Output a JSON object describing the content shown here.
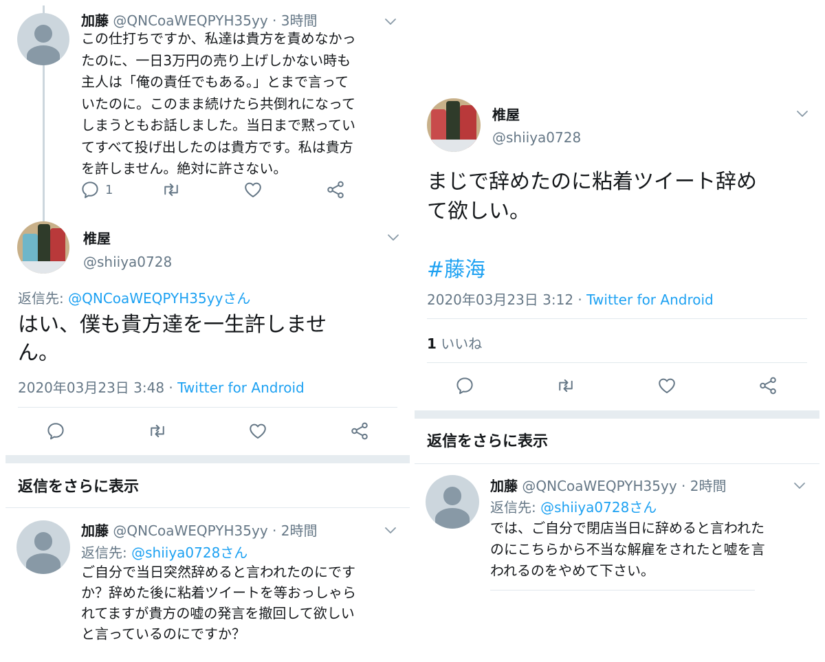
{
  "left": {
    "tweet1": {
      "name": "加藤",
      "handle_time": "@QNCoaWEQPYH35yy · 3時間",
      "lines": [
        "この仕打ちですか、私達は貴方を責めなかっ",
        "たのに、一日3万円の売り上げしかない時も",
        "主人は「俺の責任でもある。」とまで言って",
        "いたのに。このまま続けたら共倒れになって",
        "しまうともお話しました。当日まで黙ってい",
        "てすべて投げ出したのは貴方です。私は貴方",
        "を許しません。絶対に許さない。"
      ],
      "reply_count": "1"
    },
    "main": {
      "name": "椎屋",
      "handle": "@shiiya0728",
      "reply_label": "返信先: ",
      "reply_to": "@QNCoaWEQPYH35yyさん",
      "lines": [
        "はい、僕も貴方達を一生許しませ",
        "ん。"
      ],
      "date": "2020年03月23日 3:48 · ",
      "source": "Twitter for Android"
    },
    "more_replies": "返信をさらに表示",
    "tweet3": {
      "name": "加藤",
      "handle_time": "@QNCoaWEQPYH35yy · 2時間",
      "reply_label": "返信先: ",
      "reply_to": "@shiiya0728さん",
      "lines": [
        "ご自分で当日突然辞めると言われたのにです",
        "か？辞めた後に粘着ツイートを等おっしゃら",
        "れてますが貴方の嘘の発言を撤回して欲しい",
        "と言っているのにですか？"
      ]
    }
  },
  "right": {
    "main": {
      "name": "椎屋",
      "handle": "@shiiya0728",
      "lines": [
        "まじで辞めたのに粘着ツイート辞め",
        "て欲しい。"
      ],
      "hashtag": "#藤海",
      "date": "2020年03月23日 3:12 · ",
      "source": "Twitter for Android",
      "likes_count": "1",
      "likes_label": " いいね"
    },
    "more_replies": "返信をさらに表示",
    "tweet2": {
      "name": "加藤",
      "handle_time": "@QNCoaWEQPYH35yy · 2時間",
      "reply_label": "返信先: ",
      "reply_to": "@shiiya0728さん",
      "lines": [
        "では、ご自分で閉店当日に辞めると言われた",
        "のにこちらから不当な解雇をされたと嘘を言",
        "われるのをやめて下さい。"
      ]
    }
  },
  "colors": {
    "link": "#1da1f2",
    "secondary": "#657786",
    "text": "#14171a",
    "divider": "#e1e8ed"
  }
}
